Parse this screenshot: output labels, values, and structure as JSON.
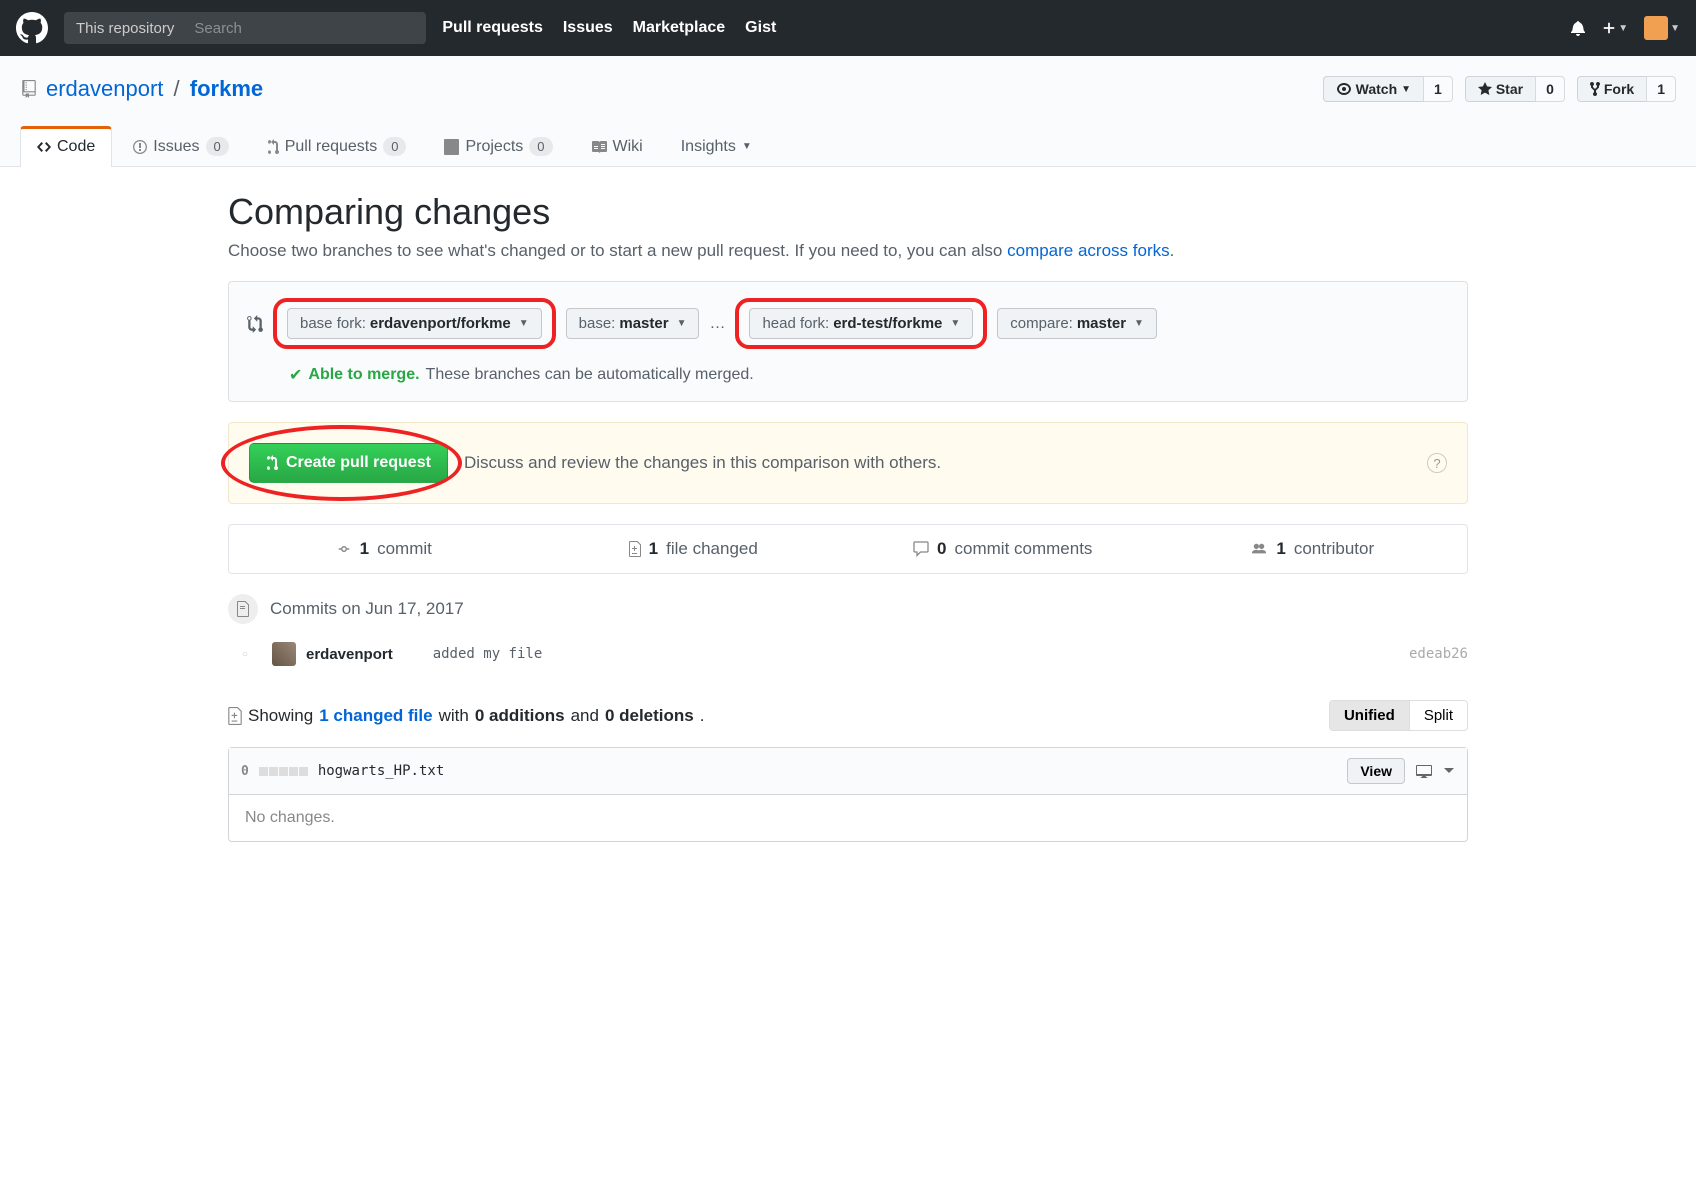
{
  "header": {
    "search_scope": "This repository",
    "search_placeholder": "Search",
    "nav": [
      "Pull requests",
      "Issues",
      "Marketplace",
      "Gist"
    ]
  },
  "repo": {
    "owner": "erdavenport",
    "name": "forkme",
    "watch_label": "Watch",
    "watch_count": "1",
    "star_label": "Star",
    "star_count": "0",
    "fork_label": "Fork",
    "fork_count": "1"
  },
  "tabs": {
    "code": "Code",
    "issues": "Issues",
    "issues_count": "0",
    "prs": "Pull requests",
    "prs_count": "0",
    "projects": "Projects",
    "projects_count": "0",
    "wiki": "Wiki",
    "insights": "Insights"
  },
  "compare": {
    "title": "Comparing changes",
    "subtitle_pre": "Choose two branches to see what's changed or to start a new pull request. If you need to, you can also ",
    "subtitle_link": "compare across forks",
    "base_fork_label": "base fork:",
    "base_fork_value": "erdavenport/forkme",
    "base_label": "base:",
    "base_value": "master",
    "head_fork_label": "head fork:",
    "head_fork_value": "erd-test/forkme",
    "compare_label": "compare:",
    "compare_value": "master",
    "merge_ok": "Able to merge.",
    "merge_desc": "These branches can be automatically merged."
  },
  "pr_banner": {
    "button": "Create pull request",
    "text": "Discuss and review the changes in this comparison with others."
  },
  "stats": {
    "commits_n": "1",
    "commits_t": "commit",
    "files_n": "1",
    "files_t": "file changed",
    "comments_n": "0",
    "comments_t": "commit comments",
    "contrib_n": "1",
    "contrib_t": "contributor"
  },
  "timeline": {
    "heading": "Commits on Jun 17, 2017",
    "author": "erdavenport",
    "message": "added my file",
    "sha": "edeab26"
  },
  "files_header": {
    "showing": "Showing ",
    "link": "1 changed file",
    "mid": " with ",
    "add": "0 additions",
    "and": " and ",
    "del": "0 deletions",
    "unified": "Unified",
    "split": "Split"
  },
  "file": {
    "stat": "0",
    "name": "hogwarts_HP.txt",
    "view": "View",
    "body": "No changes."
  }
}
